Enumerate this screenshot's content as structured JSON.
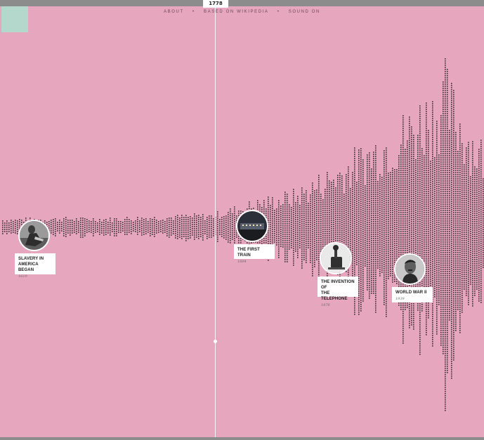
{
  "timeline": {
    "current_year": "1778"
  },
  "nav": {
    "about": "ABOUT",
    "separator": "•",
    "source": "BASED ON WIKIPEDIA",
    "sound": "SOUND ON"
  },
  "colors": {
    "background": "#e6a6bd",
    "corner_square": "#b4d8cc",
    "bars": "#4a3a40",
    "cursor": "#ffffff",
    "frame": "#8c8c8c"
  },
  "events": [
    {
      "title": "SLAVERY IN\nAMERICA BEGAN",
      "year": "1619",
      "icon": "shackled-person-photo"
    },
    {
      "title": "THE FIRST TRAIN",
      "year": "1804",
      "icon": "train-photo"
    },
    {
      "title": "THE INVENTION OF\nTHE TELEPHONE",
      "year": "1876",
      "icon": "telephone-photo"
    },
    {
      "title": "WORLD WAR II",
      "year": "1939",
      "icon": "portrait-photo"
    }
  ]
}
